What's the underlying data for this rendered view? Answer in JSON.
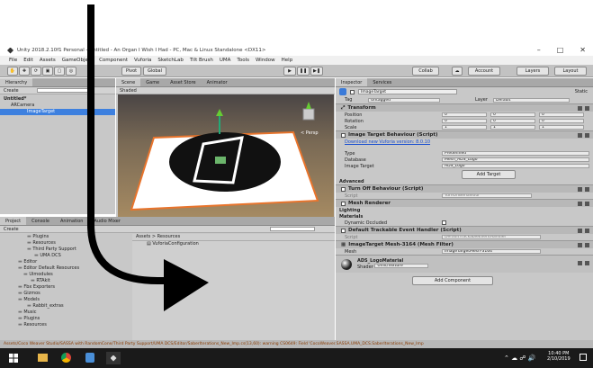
{
  "window": {
    "title": "Unity 2018.2.10f1 Personal - Untitled - An Organ I Wish I Had - PC, Mac & Linux Standalone <DX11>"
  },
  "menubar": [
    "File",
    "Edit",
    "Assets",
    "GameObject",
    "Component",
    "Vuforia",
    "SketchLab",
    "Tilt Brush",
    "UMA",
    "Tools",
    "Window",
    "Help"
  ],
  "toolbar": {
    "pivot": "Pivot",
    "global": "Global",
    "collab": "Collab",
    "account": "Account",
    "layers": "Layers",
    "layout": "Layout"
  },
  "hierarchy": {
    "tab": "Hierarchy",
    "create": "Create",
    "items": [
      "Untitled*",
      "ARCamera",
      "ImageTarget"
    ]
  },
  "scene": {
    "tabs": [
      "Scene",
      "Game",
      "Asset Store",
      "Animator"
    ],
    "shading": "Shaded",
    "persp": "< Persp"
  },
  "project": {
    "tabs": [
      "Project",
      "Console",
      "Animation",
      "Audio Mixer"
    ],
    "create": "Create",
    "folders": [
      "Plugins",
      "Resources",
      "Third Party Support",
      "UMA DCS",
      "Editor",
      "Editor Default Resources",
      "Uimodules",
      "RTAkit",
      "Fbx Exporters",
      "Gizmos",
      "Models",
      "Rabbit_extras",
      "Music",
      "Plugins",
      "Resources"
    ],
    "breadcrumb": "Assets > Resources",
    "asset": "VuforiaConfiguration"
  },
  "inspector": {
    "tabs": [
      "Inspector",
      "Services"
    ],
    "object_name": "ImageTarget",
    "static": "Static",
    "tag_label": "Tag",
    "tag_value": "Untagged",
    "layer_label": "Layer",
    "layer_value": "Default",
    "transform": {
      "title": "Transform",
      "rows": [
        {
          "label": "Position",
          "x": "0",
          "y": "0",
          "z": "0"
        },
        {
          "label": "Rotation",
          "x": "0",
          "y": "0",
          "z": "0"
        },
        {
          "label": "Scale",
          "x": "1",
          "y": "1",
          "z": "1"
        }
      ]
    },
    "image_target": {
      "title": "Image Target Behaviour (Script)",
      "link": "Download new Vuforia version: 8.0.10",
      "type_label": "Type",
      "type_value": "Predefined",
      "db_label": "Database",
      "db_value": "Mesh_ADS_Logo",
      "target_label": "Image Target",
      "target_value": "ADS_Logo",
      "add_target": "Add Target",
      "advanced": "Advanced"
    },
    "turn_off": {
      "title": "Turn Off Behaviour (Script)",
      "script_label": "Script",
      "script_value": "TurnOffBehaviour"
    },
    "mesh_renderer": {
      "title": "Mesh Renderer",
      "lighting": "Lighting",
      "materials": "Materials",
      "dynamic": "Dynamic Occluded"
    },
    "trackable": {
      "title": "Default Trackable Event Handler (Script)",
      "script_label": "Script",
      "script_value": "DefaultTrackableEventHandler"
    },
    "mesh_filter": {
      "title": "ImageTarget Mesh-3164 (Mesh Filter)",
      "mesh_label": "Mesh",
      "mesh_value": "ImageTargetMesh-3164"
    },
    "material": {
      "name": "ADS_LogoMaterial",
      "shader_label": "Shader",
      "shader_value": "Unlit/Texture"
    },
    "add_component": "Add Component"
  },
  "statusbar": "Assets/Coco Weaver Studio/SASSA with RandomCone/Third Party Support/UMA DCS/Editor/SaberIterations_New_Imp.cs(13,60): warning CS0649: Field 'CocoWeaver.SASSA.UMA_DCS.SaberIterations_New_Imp",
  "taskbar": {
    "time": "10:40 PM",
    "date": "2/10/2019"
  },
  "colors": {
    "selection": "#3d80df",
    "toolbar": "#c2c2c2",
    "panel": "#c8c8c8",
    "arrow": "#000000",
    "taskbar": "#1a1a1a"
  }
}
